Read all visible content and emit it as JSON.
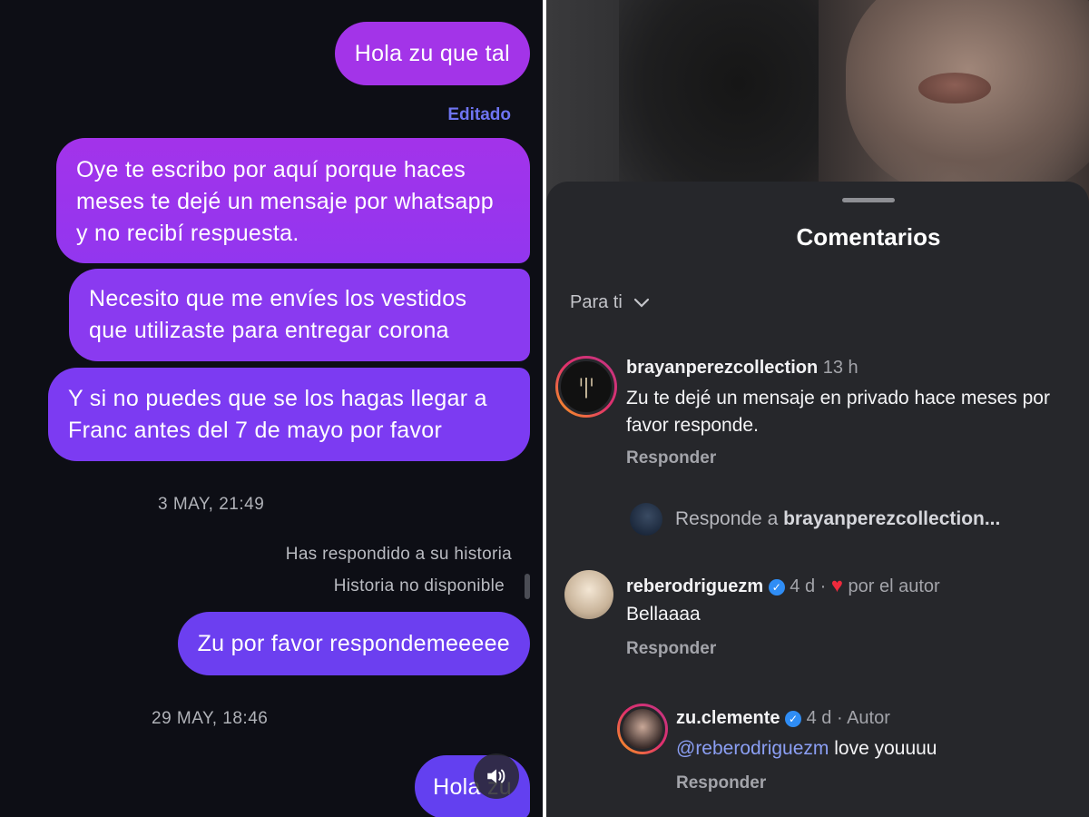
{
  "chat": {
    "msg1": "Hola zu que tal",
    "edited_label": "Editado",
    "msg2": "Oye te escribo por aquí porque haces meses te dejé  un mensaje por whatsapp y no recibí respuesta.",
    "msg3": "Necesito que me envíes los vestidos que utilizaste para entregar corona",
    "msg4": "Y si no puedes que se los hagas llegar a Franc antes del 7 de mayo por favor",
    "timestamp1": "3 MAY, 21:49",
    "story_reply_note": "Has respondido a su historia",
    "story_unavailable": "Historia no disponible",
    "msg5": "Zu por favor respondemeeeee",
    "timestamp2": "29 MAY, 18:46",
    "msg6": "Hola zu",
    "speaker_icon": "speaker-icon"
  },
  "comments": {
    "title": "Comentarios",
    "sort_label": "Para ti",
    "items": [
      {
        "username": "brayanperezcollection",
        "time": "13 h",
        "text": "Zu te dejé un mensaje en privado hace meses por favor responde.",
        "reply_label": "Responder"
      },
      {
        "username": "reberodriguezm",
        "time": "4 d ·",
        "liked_by_author": "por el autor",
        "text": "Bellaaaa",
        "reply_label": "Responder"
      }
    ],
    "reply_input": {
      "prefix": "Responde a",
      "target": "brayanperezcollection..."
    },
    "nested_reply": {
      "username": "zu.clemente",
      "time": "4 d · Autor",
      "mention": "@reberodriguezm",
      "text": " love youuuu",
      "reply_label": "Responder"
    },
    "colors": {
      "accent_mention": "#8b9ff4",
      "verified": "#2f8df5",
      "heart": "#ee2a3c"
    }
  }
}
